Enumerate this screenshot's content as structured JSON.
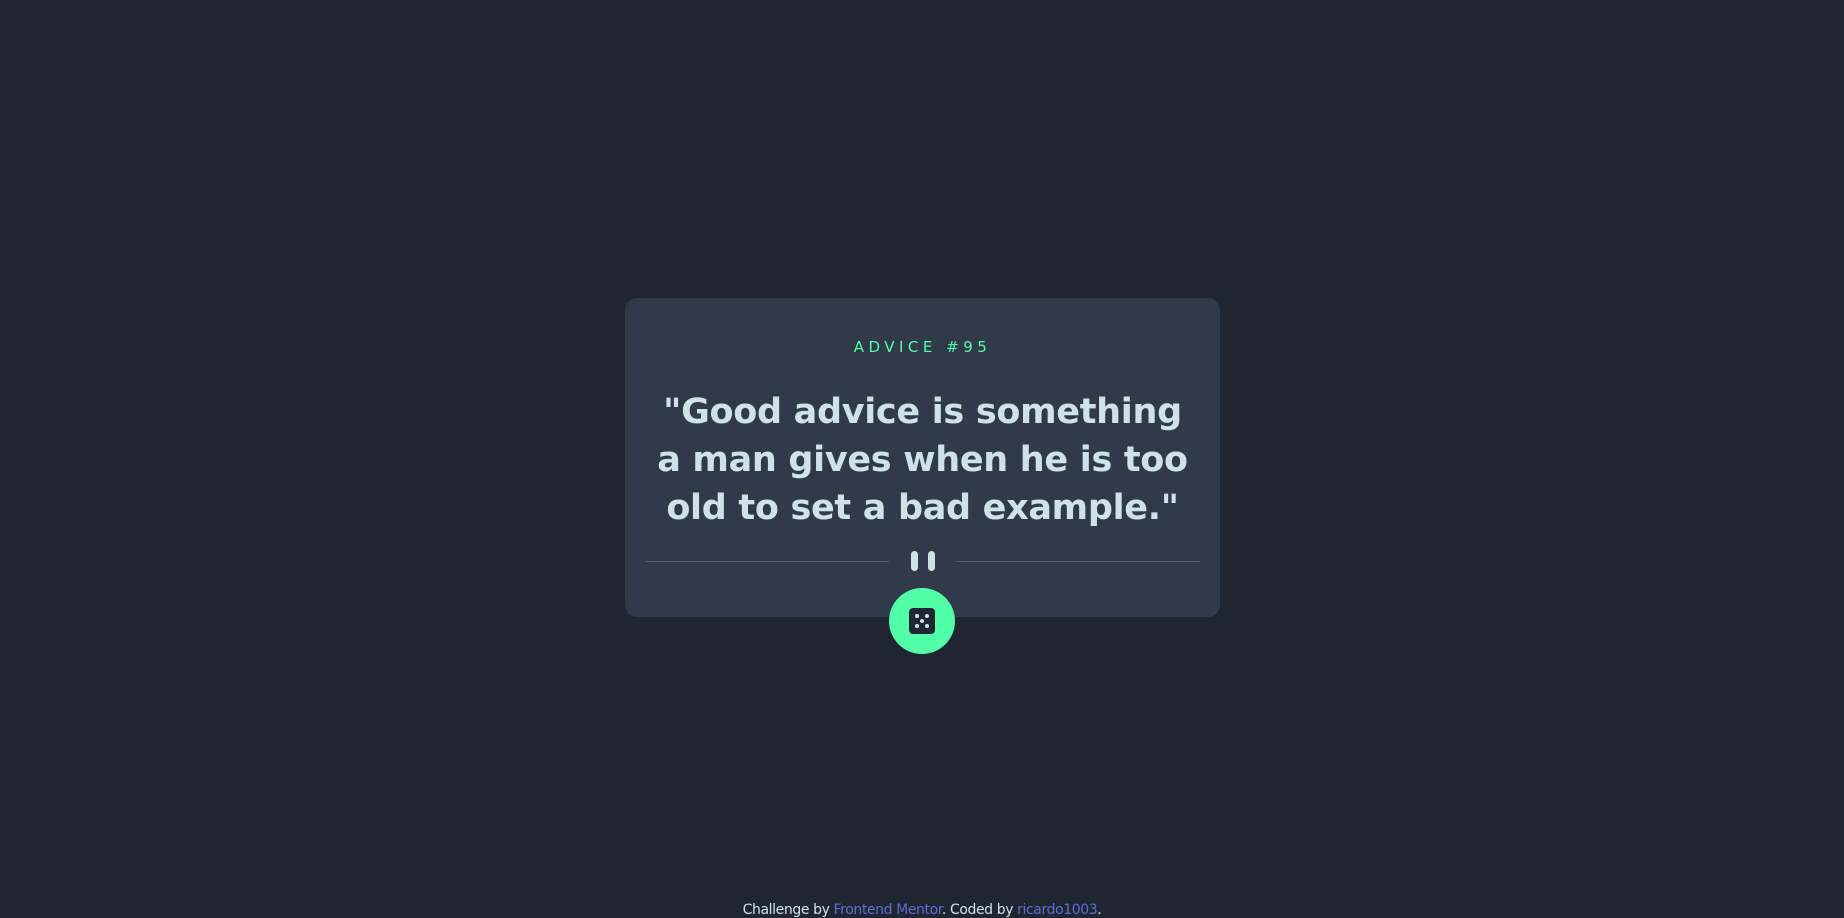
{
  "card": {
    "label": "ADVICE #95",
    "quote": "\"Good advice is something a man gives when he is too old to set a bad example.\""
  },
  "dice_button": {
    "icon": "dice-icon"
  },
  "footer": {
    "prefix": "Challenge by ",
    "link1": "Frontend Mentor",
    "middle": ". Coded by ",
    "link2": "ricardo1003",
    "suffix": "."
  },
  "colors": {
    "background": "#1f2632",
    "card": "#313a48",
    "accent": "#52ffa8",
    "text": "#cee3e9",
    "link": "#5c6ed1",
    "divider": "#4f5d74"
  }
}
